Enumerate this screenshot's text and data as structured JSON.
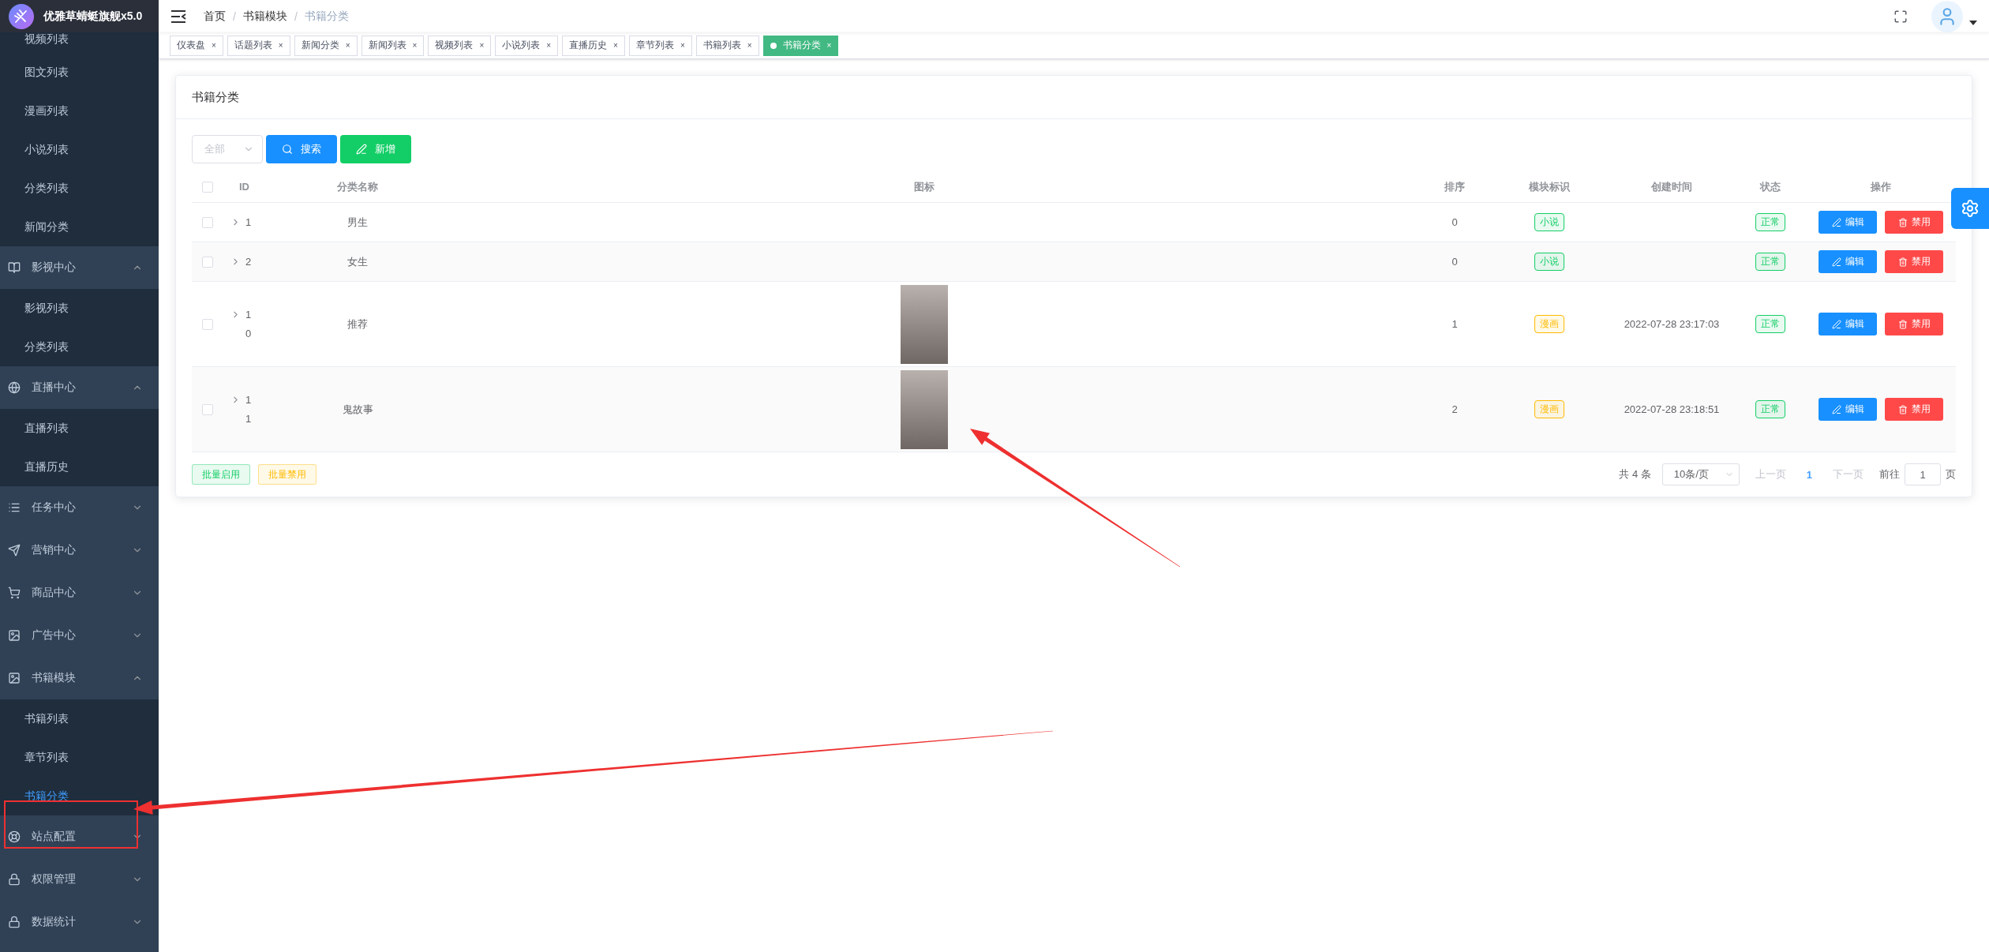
{
  "app": {
    "title": "优雅草蜻蜓旗舰x5.0"
  },
  "sidebar": {
    "items": [
      {
        "kind": "link",
        "label": "视频列表",
        "selected": false
      },
      {
        "kind": "link",
        "label": "图文列表",
        "selected": false
      },
      {
        "kind": "link",
        "label": "漫画列表",
        "selected": false
      },
      {
        "kind": "link",
        "label": "小说列表",
        "selected": false
      },
      {
        "kind": "link",
        "label": "分类列表",
        "selected": false
      },
      {
        "kind": "link",
        "label": "新闻分类",
        "selected": false
      },
      {
        "kind": "group",
        "label": "影视中心",
        "expanded": true,
        "children": [
          {
            "label": "影视列表",
            "selected": false
          },
          {
            "label": "分类列表",
            "selected": false
          }
        ]
      },
      {
        "kind": "group",
        "label": "直播中心",
        "expanded": true,
        "children": [
          {
            "label": "直播列表",
            "selected": false
          },
          {
            "label": "直播历史",
            "selected": false
          }
        ]
      },
      {
        "kind": "group",
        "label": "任务中心",
        "expanded": false
      },
      {
        "kind": "group",
        "label": "营销中心",
        "expanded": false
      },
      {
        "kind": "group",
        "label": "商品中心",
        "expanded": false
      },
      {
        "kind": "group",
        "label": "广告中心",
        "expanded": false
      },
      {
        "kind": "group",
        "label": "书籍模块",
        "expanded": true,
        "children": [
          {
            "label": "书籍列表",
            "selected": false
          },
          {
            "label": "章节列表",
            "selected": false
          },
          {
            "label": "书籍分类",
            "selected": true
          }
        ]
      },
      {
        "kind": "group",
        "label": "站点配置",
        "expanded": false
      },
      {
        "kind": "group",
        "label": "权限管理",
        "expanded": false
      },
      {
        "kind": "group",
        "label": "数据统计",
        "expanded": false
      }
    ]
  },
  "breadcrumb": [
    {
      "label": "首页",
      "current": false
    },
    {
      "label": "书籍模块",
      "current": false
    },
    {
      "label": "书籍分类",
      "current": true
    }
  ],
  "breadcrumb_separator": "/",
  "tabs": [
    {
      "label": "仪表盘",
      "selected": false
    },
    {
      "label": "话题列表",
      "selected": false
    },
    {
      "label": "新闻分类",
      "selected": false
    },
    {
      "label": "新闻列表",
      "selected": false
    },
    {
      "label": "视频列表",
      "selected": false
    },
    {
      "label": "小说列表",
      "selected": false
    },
    {
      "label": "直播历史",
      "selected": false
    },
    {
      "label": "章节列表",
      "selected": false
    },
    {
      "label": "书籍列表",
      "selected": false
    },
    {
      "label": "书籍分类",
      "selected": true
    }
  ],
  "tab_close": "×",
  "card": {
    "title": "书籍分类",
    "filter": {
      "placeholder": "全部"
    },
    "buttons": [
      {
        "kind": "search",
        "label": "搜索"
      },
      {
        "kind": "add",
        "label": "新增"
      }
    ],
    "table": {
      "header_checked": false,
      "columns": [
        "ID",
        "分类名称",
        "图标",
        "排序",
        "模块标识",
        "创建时间",
        "状态",
        "操作"
      ],
      "rows": [
        {
          "checked": false,
          "id": "1",
          "name": "男生",
          "icon": false,
          "sort": "0",
          "module": "小说",
          "color": "#13ce66",
          "created": "",
          "status": "正常",
          "edit": "编辑",
          "disable": "禁用"
        },
        {
          "checked": false,
          "id": "2",
          "name": "女生",
          "icon": false,
          "sort": "0",
          "module": "小说",
          "color": "#13ce66",
          "created": "",
          "status": "正常",
          "edit": "编辑",
          "disable": "禁用"
        },
        {
          "checked": false,
          "id": "10",
          "name": "推荐",
          "icon": true,
          "sort": "1",
          "module": "漫画",
          "color": "#ffba00",
          "created": "2022-07-28 23:17:03",
          "status": "正常",
          "edit": "编辑",
          "disable": "禁用"
        },
        {
          "checked": false,
          "id": "11",
          "name": "鬼故事",
          "icon": true,
          "sort": "2",
          "module": "漫画",
          "color": "#ffba00",
          "created": "2022-07-28 23:18:51",
          "status": "正常",
          "edit": "编辑",
          "disable": "禁用"
        }
      ]
    },
    "batch": [
      {
        "kind": "enable",
        "label": "批量启用"
      },
      {
        "kind": "disable",
        "label": "批量禁用"
      }
    ],
    "pagination": {
      "total": "共 4 条",
      "page_size": "10条/页",
      "prev": "上一页",
      "pages": [
        {
          "label": "1",
          "selected": true
        }
      ],
      "next": "下一页",
      "goto": "前往",
      "goto_value": "1",
      "goto_suffix": "页"
    }
  }
}
